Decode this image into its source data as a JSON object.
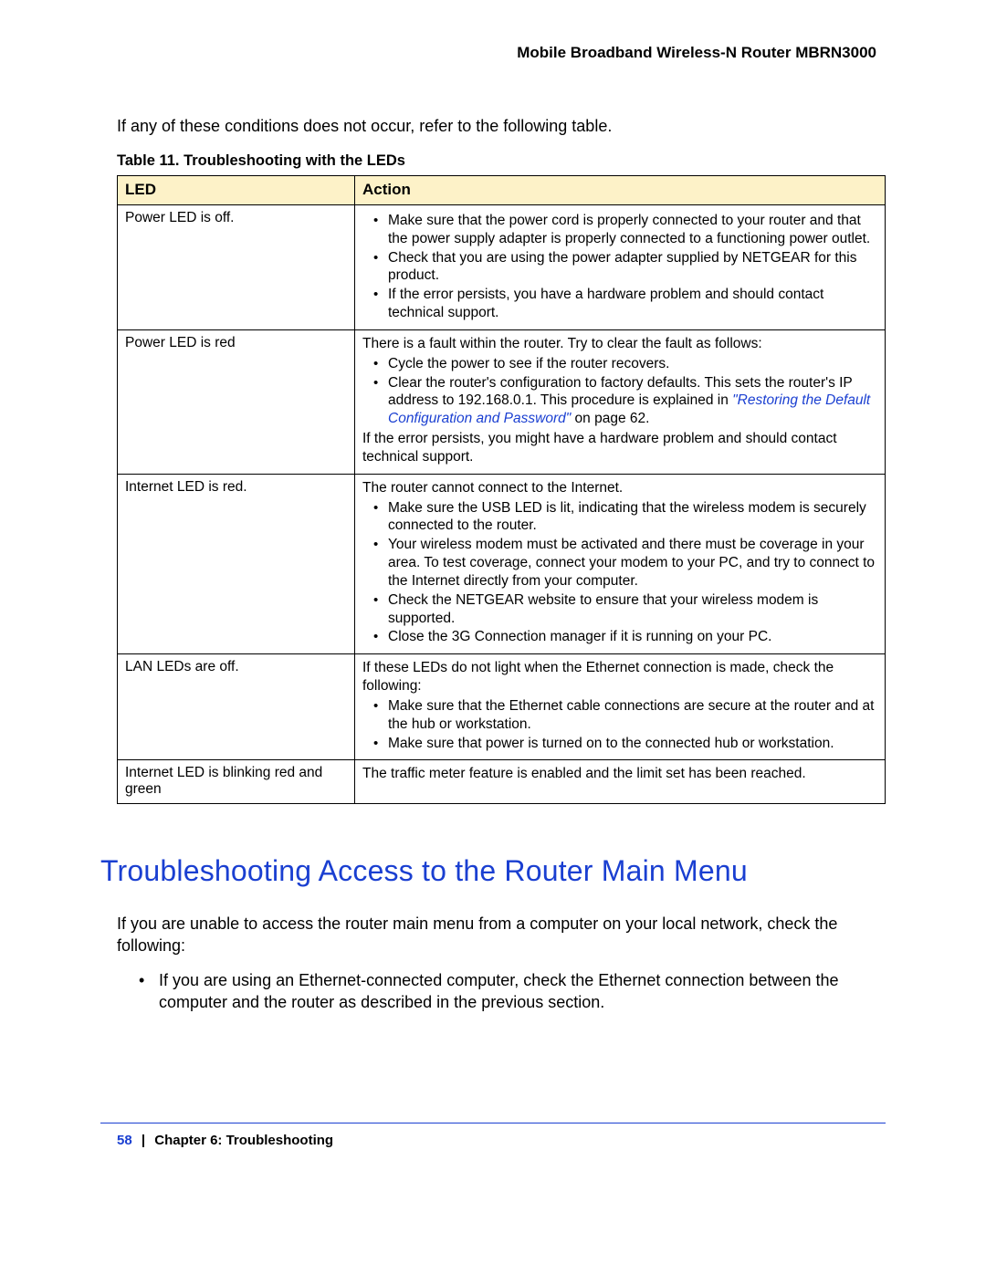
{
  "header": {
    "product": "Mobile Broadband Wireless-N Router MBRN3000"
  },
  "intro": "If any of these conditions does not occur, refer to the following table.",
  "table": {
    "caption": "Table 11.  Troubleshooting with the LEDs",
    "col_led": "LED",
    "col_action": "Action",
    "rows": {
      "r1": {
        "led": "Power LED is off.",
        "b1": "Make sure that the power cord is properly connected to your router and that the power supply adapter is properly connected to a functioning power outlet.",
        "b2": "Check that you are using the power adapter supplied by NETGEAR for this product.",
        "b3": "If the error persists, you have a hardware problem and should contact technical support."
      },
      "r2": {
        "led": "Power LED is red",
        "p1": "There is a fault within the router. Try to clear the fault as follows:",
        "b1": "Cycle the power to see if the router recovers.",
        "b2a": "Clear the router's configuration to factory defaults. This sets the router's IP address to 192.168.0.1. This procedure is explained in ",
        "b2link": "\"Restoring the Default Configuration and Password\"",
        "b2b": " on page 62.",
        "p2": "If the error persists, you might have a hardware problem and should contact technical support."
      },
      "r3": {
        "led": "Internet LED is red.",
        "p1": "The router cannot connect to the Internet.",
        "b1": "Make sure the USB LED is lit, indicating that the wireless modem is securely connected to the router.",
        "b2": "Your wireless modem must be activated and there must be coverage in your area. To test coverage, connect your modem to your PC, and try to connect to the Internet directly from your computer.",
        "b3": "Check the NETGEAR website to ensure that your wireless modem is supported.",
        "b4": "Close the 3G Connection manager if it is running on your PC."
      },
      "r4": {
        "led": "LAN LEDs are off.",
        "p1": "If these LEDs do not light when the Ethernet connection is made, check the following:",
        "b1": "Make sure that the Ethernet cable connections are secure at the router and at the hub or workstation.",
        "b2": "Make sure that power is turned on to the connected hub or workstation."
      },
      "r5": {
        "led": "Internet LED is blinking red and green",
        "p1": "The traffic meter feature is enabled and the limit set has been reached."
      }
    }
  },
  "section": {
    "heading": "Troubleshooting Access to the Router Main Menu",
    "p1": "If you are unable to access the router main menu from a computer on your local network, check the following:",
    "l1": "If you are using an Ethernet-connected computer, check the Ethernet connection between the computer and the router as described in the previous section."
  },
  "footer": {
    "page": "58",
    "sep": "|",
    "chapter": "Chapter 6:  Troubleshooting"
  }
}
